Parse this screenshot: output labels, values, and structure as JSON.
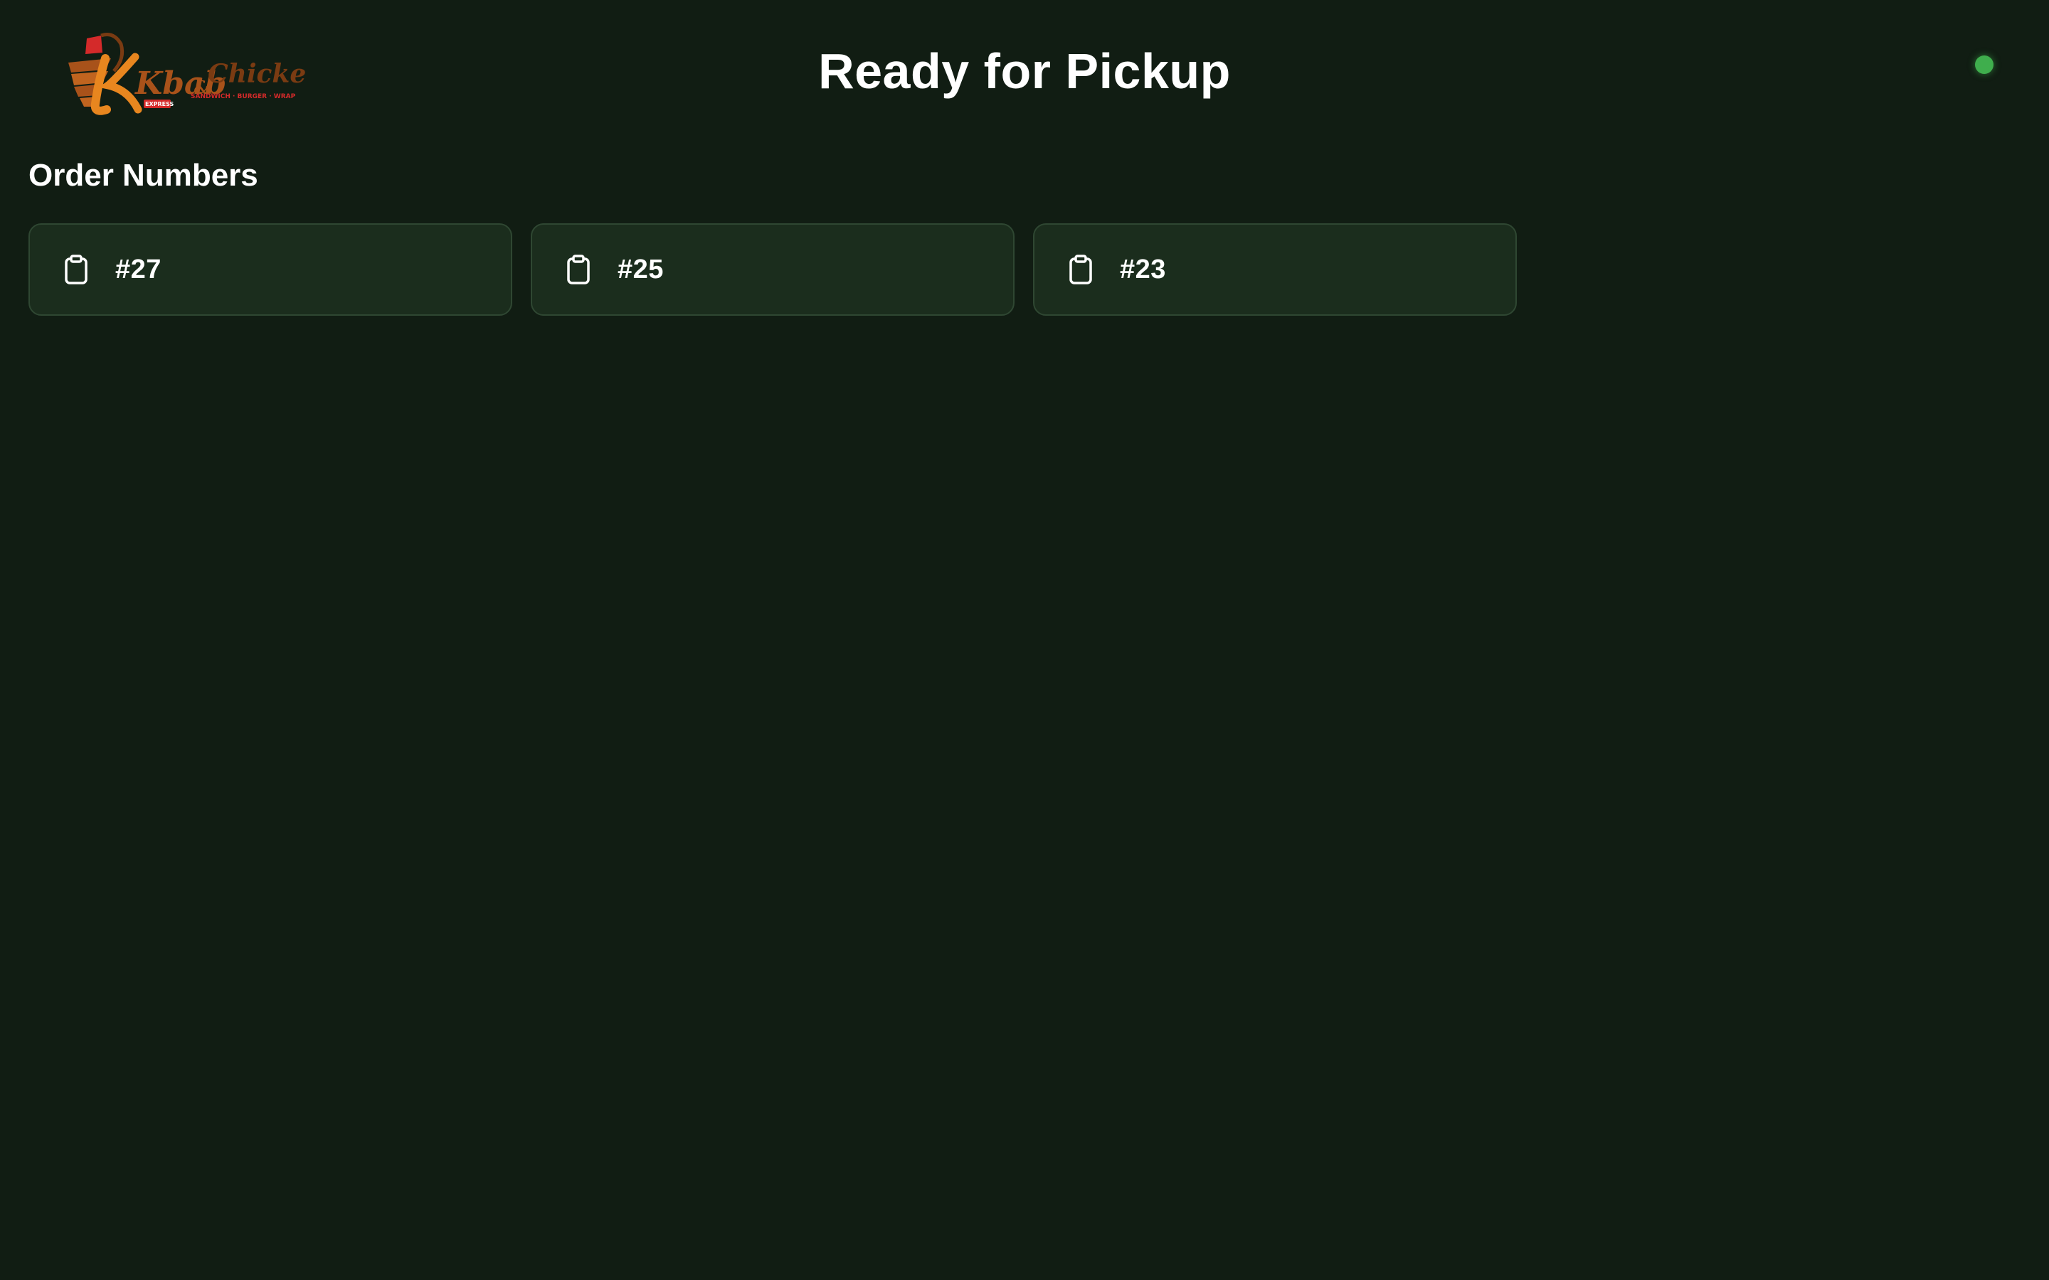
{
  "brand": {
    "logo_text_main": "Kbab",
    "logo_text_amp": "&",
    "logo_text_secondary": "Chicken",
    "logo_tagline": "SANDWICH · BURGER · WRAP",
    "logo_badge": "EXPRESS",
    "colors": {
      "orange": "#e8861f",
      "red": "#d42a2a",
      "brown": "#7a3b12"
    }
  },
  "header": {
    "title": "Ready for Pickup",
    "status_color": "#3fae4d"
  },
  "section": {
    "title": "Order Numbers"
  },
  "orders": [
    {
      "number": "#27",
      "icon": "clipboard-icon"
    },
    {
      "number": "#25",
      "icon": "clipboard-icon"
    },
    {
      "number": "#23",
      "icon": "clipboard-icon"
    }
  ],
  "theme": {
    "background": "#111d13",
    "card_background": "#1b2d1d",
    "card_border": "#2f4732"
  }
}
